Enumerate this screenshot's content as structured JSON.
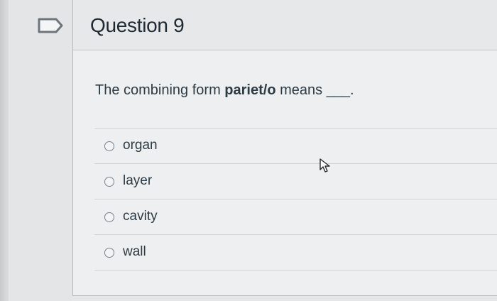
{
  "question": {
    "title": "Question 9",
    "text_prefix": "The combining form ",
    "text_term": "pariet/o",
    "text_suffix": " means ___."
  },
  "answers": [
    {
      "label": "organ",
      "selected": false
    },
    {
      "label": "layer",
      "selected": false
    },
    {
      "label": "cavity",
      "selected": false
    },
    {
      "label": "wall",
      "selected": false
    }
  ],
  "icons": {
    "flag": "bookmark-outline-icon",
    "cursor": "mouse-pointer-icon"
  },
  "colors": {
    "text": "#2d3b45",
    "background": "#eeeff0",
    "border": "#c3c5c7"
  }
}
